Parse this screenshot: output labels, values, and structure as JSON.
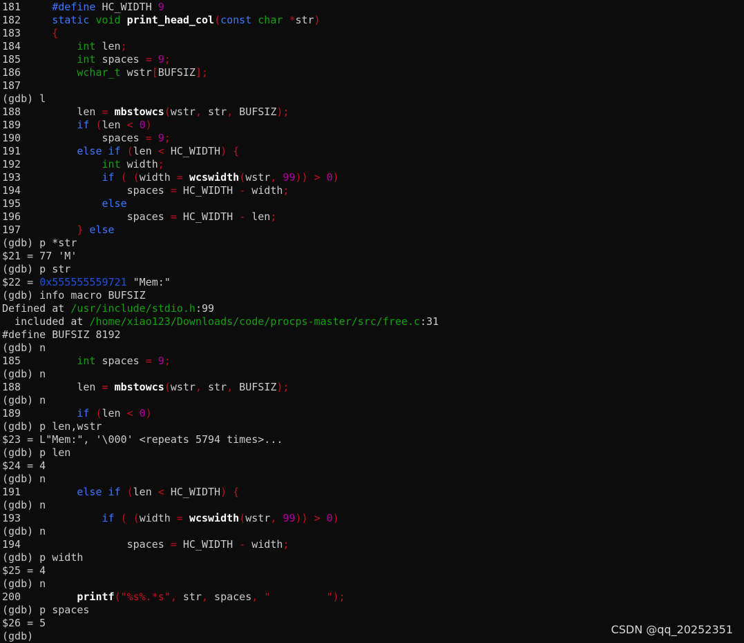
{
  "terminal": {
    "lines": [
      [
        [
          "181     ",
          "w"
        ],
        [
          "#define",
          "kw"
        ],
        [
          " HC_WIDTH ",
          "w"
        ],
        [
          "9",
          "nu"
        ]
      ],
      [
        [
          "182     ",
          "w"
        ],
        [
          "static",
          "kw"
        ],
        [
          " ",
          "w"
        ],
        [
          "void",
          "ty"
        ],
        [
          " ",
          "w"
        ],
        [
          "print_head_col",
          "b"
        ],
        [
          "(",
          "pu"
        ],
        [
          "const",
          "kw"
        ],
        [
          " ",
          "w"
        ],
        [
          "char",
          "ty"
        ],
        [
          " ",
          "w"
        ],
        [
          "*",
          "pu"
        ],
        [
          "str",
          "w"
        ],
        [
          ")",
          "pu"
        ]
      ],
      [
        [
          "183     ",
          "w"
        ],
        [
          "{",
          "pu"
        ]
      ],
      [
        [
          "184         ",
          "w"
        ],
        [
          "int",
          "ty"
        ],
        [
          " len",
          "w"
        ],
        [
          ";",
          "pu"
        ]
      ],
      [
        [
          "185         ",
          "w"
        ],
        [
          "int",
          "ty"
        ],
        [
          " spaces ",
          "w"
        ],
        [
          "=",
          "pu"
        ],
        [
          " ",
          "w"
        ],
        [
          "9",
          "nu"
        ],
        [
          ";",
          "pu"
        ]
      ],
      [
        [
          "186         ",
          "w"
        ],
        [
          "wchar_t",
          "ty"
        ],
        [
          " wstr",
          "w"
        ],
        [
          "[",
          "pu"
        ],
        [
          "BUFSIZ",
          "w"
        ],
        [
          "];",
          "pu"
        ]
      ],
      [
        [
          "187",
          "w"
        ]
      ],
      [
        [
          "(gdb) l",
          "w"
        ]
      ],
      [
        [
          "188         len ",
          "w"
        ],
        [
          "=",
          "pu"
        ],
        [
          " ",
          "w"
        ],
        [
          "mbstowcs",
          "b"
        ],
        [
          "(",
          "pu"
        ],
        [
          "wstr",
          "w"
        ],
        [
          ",",
          "pu"
        ],
        [
          " str",
          "w"
        ],
        [
          ",",
          "pu"
        ],
        [
          " BUFSIZ",
          "w"
        ],
        [
          ");",
          "pu"
        ]
      ],
      [
        [
          "189         ",
          "w"
        ],
        [
          "if",
          "kw"
        ],
        [
          " ",
          "w"
        ],
        [
          "(",
          "pu"
        ],
        [
          "len ",
          "w"
        ],
        [
          "<",
          "pu"
        ],
        [
          " ",
          "w"
        ],
        [
          "0",
          "nu"
        ],
        [
          ")",
          "pu"
        ]
      ],
      [
        [
          "190             spaces ",
          "w"
        ],
        [
          "=",
          "pu"
        ],
        [
          " ",
          "w"
        ],
        [
          "9",
          "nu"
        ],
        [
          ";",
          "pu"
        ]
      ],
      [
        [
          "191         ",
          "w"
        ],
        [
          "else",
          "kw"
        ],
        [
          " ",
          "w"
        ],
        [
          "if",
          "kw"
        ],
        [
          " ",
          "w"
        ],
        [
          "(",
          "pu"
        ],
        [
          "len ",
          "w"
        ],
        [
          "<",
          "pu"
        ],
        [
          " HC_WIDTH",
          "w"
        ],
        [
          ")",
          "pu"
        ],
        [
          " ",
          "w"
        ],
        [
          "{",
          "pu"
        ]
      ],
      [
        [
          "192             ",
          "w"
        ],
        [
          "int",
          "ty"
        ],
        [
          " width",
          "w"
        ],
        [
          ";",
          "pu"
        ]
      ],
      [
        [
          "193             ",
          "w"
        ],
        [
          "if",
          "kw"
        ],
        [
          " ",
          "w"
        ],
        [
          "(",
          "pu"
        ],
        [
          " ",
          "w"
        ],
        [
          "(",
          "pu"
        ],
        [
          "width ",
          "w"
        ],
        [
          "=",
          "pu"
        ],
        [
          " ",
          "w"
        ],
        [
          "wcswidth",
          "b"
        ],
        [
          "(",
          "pu"
        ],
        [
          "wstr",
          "w"
        ],
        [
          ",",
          "pu"
        ],
        [
          " ",
          "w"
        ],
        [
          "99",
          "nu"
        ],
        [
          "))",
          "pu"
        ],
        [
          " ",
          "w"
        ],
        [
          ">",
          "pu"
        ],
        [
          " ",
          "w"
        ],
        [
          "0",
          "nu"
        ],
        [
          ")",
          "pu"
        ]
      ],
      [
        [
          "194                 spaces ",
          "w"
        ],
        [
          "=",
          "pu"
        ],
        [
          " HC_WIDTH ",
          "w"
        ],
        [
          "-",
          "pu"
        ],
        [
          " width",
          "w"
        ],
        [
          ";",
          "pu"
        ]
      ],
      [
        [
          "195             ",
          "w"
        ],
        [
          "else",
          "kw"
        ]
      ],
      [
        [
          "196                 spaces ",
          "w"
        ],
        [
          "=",
          "pu"
        ],
        [
          " HC_WIDTH ",
          "w"
        ],
        [
          "-",
          "pu"
        ],
        [
          " len",
          "w"
        ],
        [
          ";",
          "pu"
        ]
      ],
      [
        [
          "197         ",
          "w"
        ],
        [
          "}",
          "pu"
        ],
        [
          " ",
          "w"
        ],
        [
          "else",
          "kw"
        ]
      ],
      [
        [
          "(gdb) p *str",
          "w"
        ]
      ],
      [
        [
          "$21 = 77 'M'",
          "w"
        ]
      ],
      [
        [
          "(gdb) p str",
          "w"
        ]
      ],
      [
        [
          "$22 = ",
          "w"
        ],
        [
          "0x555555559721",
          "ad"
        ],
        [
          " \"Mem:\"",
          "w"
        ]
      ],
      [
        [
          "(gdb) info macro BUFSIZ",
          "w"
        ]
      ],
      [
        [
          "Defined at ",
          "w"
        ],
        [
          "/usr/include/stdio.h",
          "pa"
        ],
        [
          ":99",
          "w"
        ]
      ],
      [
        [
          "  included at ",
          "w"
        ],
        [
          "/home/xiao123/Downloads/code/procps-master/src/free.c",
          "pa"
        ],
        [
          ":31",
          "w"
        ]
      ],
      [
        [
          "#define BUFSIZ 8192",
          "w"
        ]
      ],
      [
        [
          "(gdb) n",
          "w"
        ]
      ],
      [
        [
          "185         ",
          "w"
        ],
        [
          "int",
          "ty"
        ],
        [
          " spaces ",
          "w"
        ],
        [
          "=",
          "pu"
        ],
        [
          " ",
          "w"
        ],
        [
          "9",
          "nu"
        ],
        [
          ";",
          "pu"
        ]
      ],
      [
        [
          "(gdb) n",
          "w"
        ]
      ],
      [
        [
          "188         len ",
          "w"
        ],
        [
          "=",
          "pu"
        ],
        [
          " ",
          "w"
        ],
        [
          "mbstowcs",
          "b"
        ],
        [
          "(",
          "pu"
        ],
        [
          "wstr",
          "w"
        ],
        [
          ",",
          "pu"
        ],
        [
          " str",
          "w"
        ],
        [
          ",",
          "pu"
        ],
        [
          " BUFSIZ",
          "w"
        ],
        [
          ");",
          "pu"
        ]
      ],
      [
        [
          "(gdb) n",
          "w"
        ]
      ],
      [
        [
          "189         ",
          "w"
        ],
        [
          "if",
          "kw"
        ],
        [
          " ",
          "w"
        ],
        [
          "(",
          "pu"
        ],
        [
          "len ",
          "w"
        ],
        [
          "<",
          "pu"
        ],
        [
          " ",
          "w"
        ],
        [
          "0",
          "nu"
        ],
        [
          ")",
          "pu"
        ]
      ],
      [
        [
          "(gdb) p len,wstr",
          "w"
        ]
      ],
      [
        [
          "$23 = L\"Mem:\", '\\000' <repeats 5794 times>...",
          "w"
        ]
      ],
      [
        [
          "(gdb) p len",
          "w"
        ]
      ],
      [
        [
          "$24 = 4",
          "w"
        ]
      ],
      [
        [
          "(gdb) n",
          "w"
        ]
      ],
      [
        [
          "191         ",
          "w"
        ],
        [
          "else",
          "kw"
        ],
        [
          " ",
          "w"
        ],
        [
          "if",
          "kw"
        ],
        [
          " ",
          "w"
        ],
        [
          "(",
          "pu"
        ],
        [
          "len ",
          "w"
        ],
        [
          "<",
          "pu"
        ],
        [
          " HC_WIDTH",
          "w"
        ],
        [
          ")",
          "pu"
        ],
        [
          " ",
          "w"
        ],
        [
          "{",
          "pu"
        ]
      ],
      [
        [
          "(gdb) n",
          "w"
        ]
      ],
      [
        [
          "193             ",
          "w"
        ],
        [
          "if",
          "kw"
        ],
        [
          " ",
          "w"
        ],
        [
          "(",
          "pu"
        ],
        [
          " ",
          "w"
        ],
        [
          "(",
          "pu"
        ],
        [
          "width ",
          "w"
        ],
        [
          "=",
          "pu"
        ],
        [
          " ",
          "w"
        ],
        [
          "wcswidth",
          "b"
        ],
        [
          "(",
          "pu"
        ],
        [
          "wstr",
          "w"
        ],
        [
          ",",
          "pu"
        ],
        [
          " ",
          "w"
        ],
        [
          "99",
          "nu"
        ],
        [
          "))",
          "pu"
        ],
        [
          " ",
          "w"
        ],
        [
          ">",
          "pu"
        ],
        [
          " ",
          "w"
        ],
        [
          "0",
          "nu"
        ],
        [
          ")",
          "pu"
        ]
      ],
      [
        [
          "(gdb) n",
          "w"
        ]
      ],
      [
        [
          "194                 spaces ",
          "w"
        ],
        [
          "=",
          "pu"
        ],
        [
          " HC_WIDTH ",
          "w"
        ],
        [
          "-",
          "pu"
        ],
        [
          " width",
          "w"
        ],
        [
          ";",
          "pu"
        ]
      ],
      [
        [
          "(gdb) p width",
          "w"
        ]
      ],
      [
        [
          "$25 = 4",
          "w"
        ]
      ],
      [
        [
          "(gdb) n",
          "w"
        ]
      ],
      [
        [
          "200         ",
          "w"
        ],
        [
          "printf",
          "b"
        ],
        [
          "(",
          "pu"
        ],
        [
          "\"%s%.*s\"",
          "st"
        ],
        [
          ",",
          "pu"
        ],
        [
          " str",
          "w"
        ],
        [
          ",",
          "pu"
        ],
        [
          " spaces",
          "w"
        ],
        [
          ",",
          "pu"
        ],
        [
          " ",
          "w"
        ],
        [
          "\"         \"",
          "st"
        ],
        [
          ");",
          "pu"
        ]
      ],
      [
        [
          "(gdb) p spaces",
          "w"
        ]
      ],
      [
        [
          "$26 = 5",
          "w"
        ]
      ],
      [
        [
          "(gdb)",
          "w"
        ]
      ]
    ]
  },
  "watermark": "CSDN @qq_20252351",
  "colors": {
    "background": "#0c0c0c",
    "text": "#cccccc",
    "keyword": "#3b78ff",
    "type": "#13a10e",
    "punct": "#c50f1f",
    "number": "#b4009e",
    "path": "#13a10e",
    "address": "#2253d6"
  }
}
